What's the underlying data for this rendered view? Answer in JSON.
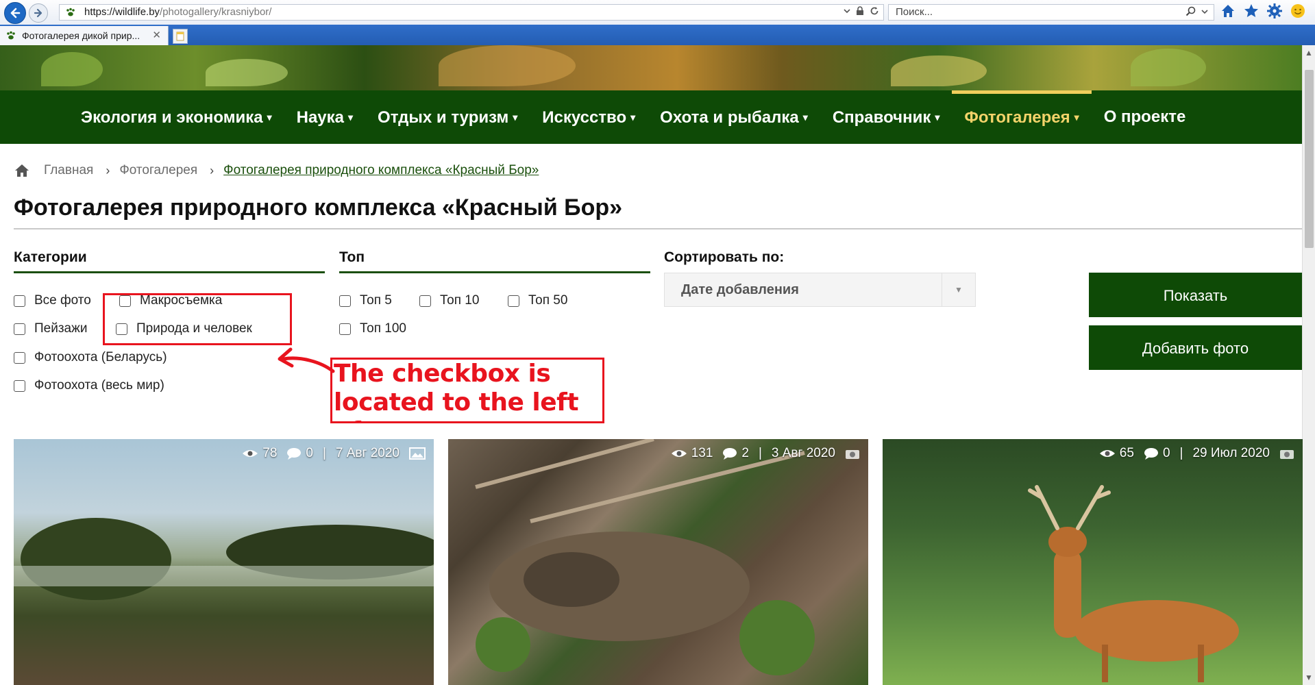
{
  "browser": {
    "url_domain": "https://wildlife.by",
    "url_path": "/photogallery/krasniybor/",
    "search_placeholder": "Поиск...",
    "tab_title": "Фотогалерея дикой прир...",
    "tab_close": "✕"
  },
  "nav": {
    "items": [
      {
        "label": "Экология и экономика",
        "caret": "▾"
      },
      {
        "label": "Наука",
        "caret": "▾"
      },
      {
        "label": "Отдых и туризм",
        "caret": "▾"
      },
      {
        "label": "Искусство",
        "caret": "▾"
      },
      {
        "label": "Охота и рыбалка",
        "caret": "▾"
      },
      {
        "label": "Справочник",
        "caret": "▾"
      },
      {
        "label": "Фотогалерея",
        "caret": "▾"
      },
      {
        "label": "О проекте",
        "caret": ""
      }
    ],
    "active_index": 6,
    "colors": {
      "bg": "#0e4a06",
      "active": "#f3d36a"
    }
  },
  "breadcrumb": {
    "home": "Главная",
    "gallery": "Фотогалерея",
    "current": "Фотогалерея природного комплекса «Красный Бор»",
    "separator": "›"
  },
  "page_title": "Фотогалерея природного комплекса «Красный Бор»",
  "filters": {
    "categories_title": "Категории",
    "categories": [
      "Все фото",
      "Макросъемка",
      "Пейзажи",
      "Природа и человек",
      "Фотоохота (Беларусь)",
      "Фотоохота (весь мир)"
    ],
    "top_title": "Топ",
    "top": [
      "Топ 5",
      "Топ 10",
      "Топ 50",
      "Топ 100"
    ],
    "sort_title": "Сортировать по:",
    "sort_selected": "Дате добавления"
  },
  "buttons": {
    "show": "Показать",
    "add_photo": "Добавить фото"
  },
  "annotation": {
    "text": "The checkbox is located to the left of",
    "color": "#e8141e"
  },
  "gallery": [
    {
      "views": "78",
      "comments": "0",
      "date": "7 Авг 2020",
      "type_icon": "image-icon"
    },
    {
      "views": "131",
      "comments": "2",
      "date": "3 Авг 2020",
      "type_icon": "camera-icon"
    },
    {
      "views": "65",
      "comments": "0",
      "date": "29 Июл 2020",
      "type_icon": "camera-icon"
    }
  ],
  "separators": {
    "meta": "|"
  }
}
